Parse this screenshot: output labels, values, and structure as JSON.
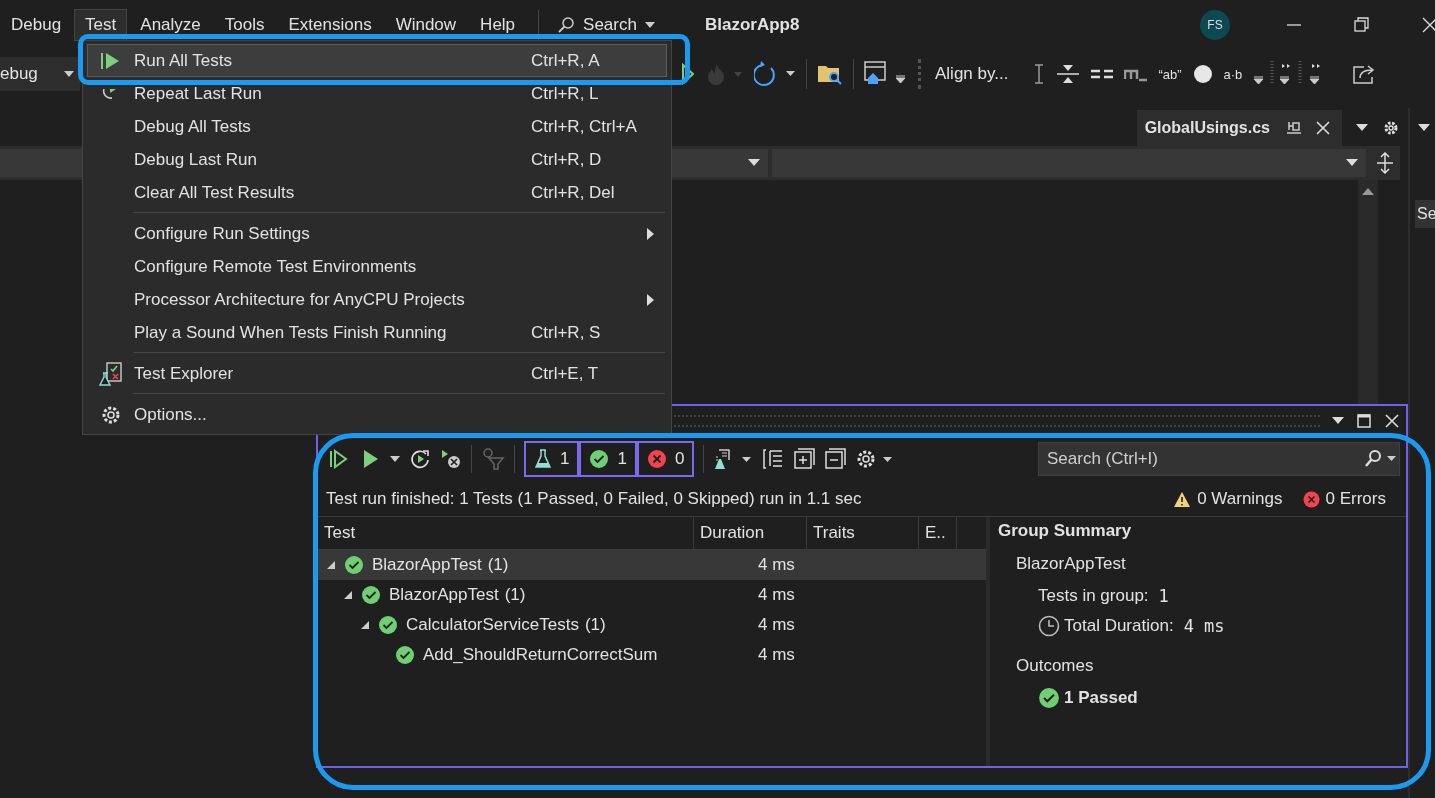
{
  "menubar": {
    "items": [
      {
        "label": "Debug",
        "selected": false
      },
      {
        "label": "Test",
        "selected": true
      },
      {
        "label": "Analyze",
        "selected": false
      },
      {
        "label": "Tools",
        "selected": false
      },
      {
        "label": "Extensions",
        "selected": false
      },
      {
        "label": "Window",
        "selected": false
      },
      {
        "label": "Help",
        "selected": false
      }
    ],
    "search": "Search",
    "title": "BlazorApp8",
    "avatar": "FS"
  },
  "toolbar": {
    "configuration": "ebug",
    "align": "Align by...",
    "glyphs": [
      "“ab”",
      "a·b"
    ]
  },
  "document_tab": {
    "title": "GlobalUsings.cs"
  },
  "side_panel": {
    "text": "Se"
  },
  "test_menu": {
    "items": [
      {
        "kind": "run",
        "label": "Run All Tests",
        "shortcut": "Ctrl+R, A",
        "selected": true
      },
      {
        "kind": "repeat",
        "label": "Repeat Last Run",
        "shortcut": "Ctrl+R, L",
        "selected": false
      },
      {
        "kind": "plain",
        "label": "Debug All Tests",
        "shortcut": "Ctrl+R, Ctrl+A",
        "selected": false
      },
      {
        "kind": "plain",
        "label": "Debug Last Run",
        "shortcut": "Ctrl+R, D",
        "selected": false
      },
      {
        "kind": "plain",
        "label": "Clear All Test Results",
        "shortcut": "Ctrl+R, Del",
        "selected": false
      },
      {
        "kind": "separator"
      },
      {
        "kind": "submenu",
        "label": "Configure Run Settings",
        "selected": false
      },
      {
        "kind": "plain",
        "label": "Configure Remote Test Environments",
        "selected": false
      },
      {
        "kind": "submenu",
        "label": "Processor Architecture for AnyCPU Projects",
        "selected": false
      },
      {
        "kind": "plain",
        "label": "Play a Sound When Tests Finish Running",
        "shortcut": "Ctrl+R, S",
        "selected": false
      },
      {
        "kind": "separator"
      },
      {
        "kind": "explorer",
        "label": "Test Explorer",
        "shortcut": "Ctrl+E, T",
        "selected": false
      },
      {
        "kind": "separator"
      },
      {
        "kind": "options",
        "label": "Options...",
        "selected": false
      }
    ]
  },
  "test_explorer": {
    "counters": [
      {
        "kind": "total",
        "count": "1"
      },
      {
        "kind": "passed",
        "count": "1"
      },
      {
        "kind": "failed",
        "count": "0"
      }
    ],
    "search": {
      "placeholder": "Search (Ctrl+I)"
    },
    "status": "Test run finished: 1 Tests (1 Passed, 0 Failed, 0 Skipped) run in 1.1 sec",
    "warnings": "0 Warnings",
    "errors": "0 Errors",
    "columns": [
      "Test",
      "Duration",
      "Traits",
      "E.."
    ],
    "rows": [
      {
        "name": "BlazorAppTest",
        "count": "(1)",
        "duration": "4 ms",
        "kind": "passed",
        "expanded": true,
        "selected": true,
        "children": [
          {
            "name": "BlazorAppTest",
            "count": "(1)",
            "duration": "4 ms",
            "kind": "passed",
            "expanded": true,
            "selected": false,
            "children": [
              {
                "name": "CalculatorServiceTests",
                "count": "(1)",
                "duration": "4 ms",
                "kind": "passed",
                "expanded": true,
                "selected": false,
                "children": [
                  {
                    "name": "Add_ShouldReturnCorrectSum",
                    "duration": "4 ms",
                    "kind": "passed",
                    "selected": false
                  }
                ]
              }
            ]
          }
        ]
      }
    ],
    "summary": {
      "title": "Group Summary",
      "group": "BlazorAppTest",
      "tests_label": "Tests in group:",
      "tests_value": "1",
      "duration_label": "Total Duration:",
      "duration_value": "4 ms",
      "outcomes_title": "Outcomes",
      "outcomes": [
        {
          "kind": "passed",
          "label": "1 Passed"
        }
      ]
    }
  }
}
